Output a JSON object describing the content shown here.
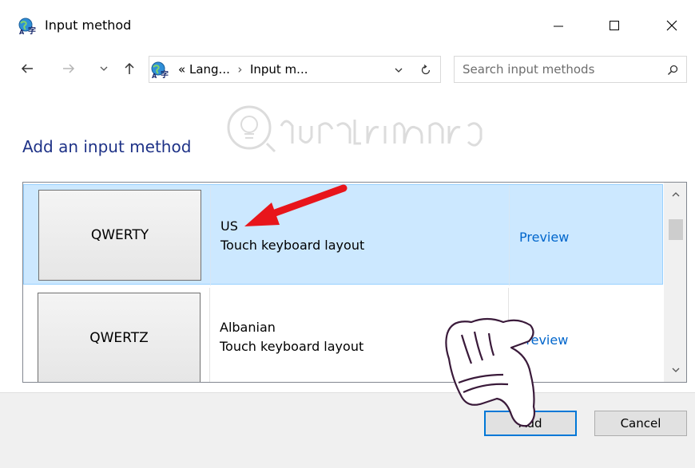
{
  "window": {
    "title": "Input method",
    "icon": "language-globe-icon",
    "controls": [
      "minimize",
      "maximize",
      "close"
    ]
  },
  "nav": {
    "address": {
      "prefix": "«",
      "crumbs": [
        "Lang...",
        "Input m..."
      ],
      "separator": "›"
    },
    "search": {
      "placeholder": "Search input methods"
    }
  },
  "main": {
    "heading": "Add an input method",
    "items": [
      {
        "keyboard": "QWERTY",
        "name": "US",
        "layout": "Touch keyboard layout",
        "preview": "Preview",
        "selected": true
      },
      {
        "keyboard": "QWERTZ",
        "name": "Albanian",
        "layout": "Touch keyboard layout",
        "preview": "Preview",
        "selected": false
      }
    ]
  },
  "footer": {
    "add_label": "Add",
    "cancel_label": "Cancel"
  },
  "watermark": {
    "text": "Quantrimang"
  },
  "colors": {
    "accent": "#0078d7",
    "heading": "#1e3287",
    "selection": "#cce8ff",
    "link": "#0066cc",
    "arrow": "#e8151b"
  }
}
